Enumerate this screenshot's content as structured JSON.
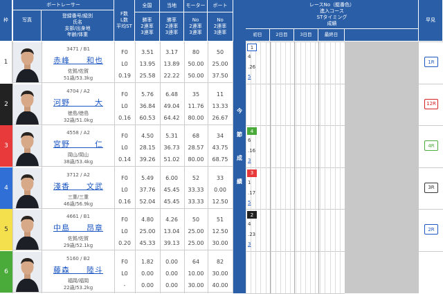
{
  "headers": {
    "waku": "枠",
    "photo": "写真",
    "boat_racer": "ボートレーサー",
    "racer_info": [
      "登録番号/級別",
      "氏名",
      "支部/出身地",
      "年齢/体重"
    ],
    "st": [
      "F数",
      "L数",
      "平均ST"
    ],
    "zenkoku": "全国",
    "touchi": "当地",
    "motor": "モーター",
    "boat": "ボート",
    "rate": [
      "勝率",
      "2連率",
      "3連率"
    ],
    "no_rate": [
      "No",
      "2連率",
      "3連率"
    ],
    "race_info": [
      "レースNo（艇番色）",
      "進入コース",
      "STタイミング",
      "成績"
    ],
    "days": [
      "初日",
      "2日目",
      "3日目",
      "最終日"
    ],
    "hayami": "早見"
  },
  "mid_label": [
    "今",
    "節",
    "成",
    "績"
  ],
  "racers": [
    {
      "waku": "1",
      "waku_color": "#ffffff",
      "waku_text": "#333333",
      "reg": "3471 / B1",
      "name": "赤峰　　和也",
      "branch": "佐賀/佐賀",
      "age_weight": "51歳/53.3kg",
      "st": [
        "F0",
        "L0",
        "0.19"
      ],
      "zenkoku": [
        "3.51",
        "13.95",
        "25.58"
      ],
      "touchi": [
        "3.17",
        "13.89",
        "22.22"
      ],
      "motor": [
        "80",
        "50.00",
        "50.00"
      ],
      "boat": [
        "50",
        "25.00",
        "37.50"
      ],
      "race": {
        "lane": "1",
        "lane_color": "#ffffff",
        "lane_text": "#333333",
        "course": "4",
        "st": ".26",
        "result": "5"
      },
      "hayami": "1R",
      "hayami_color": "#ffffff",
      "hayami_text": "#1a56c2"
    },
    {
      "waku": "2",
      "waku_color": "#222222",
      "waku_text": "#ffffff",
      "reg": "4704 / A2",
      "name": "河野　　　大",
      "branch": "徳島/徳島",
      "age_weight": "32歳/51.0kg",
      "st": [
        "F0",
        "L0",
        "0.16"
      ],
      "zenkoku": [
        "5.76",
        "36.84",
        "60.53"
      ],
      "touchi": [
        "6.48",
        "49.04",
        "64.42"
      ],
      "motor": [
        "35",
        "11.76",
        "80.00"
      ],
      "boat": [
        "11",
        "13.33",
        "26.67"
      ],
      "race": null,
      "hayami": "12R",
      "hayami_color": "#ffffff",
      "hayami_text": "#d42020"
    },
    {
      "waku": "3",
      "waku_color": "#e83a3a",
      "waku_text": "#ffffff",
      "reg": "4558 / A2",
      "name": "宮野　　　仁",
      "branch": "岡山/岡山",
      "age_weight": "38歳/53.4kg",
      "st": [
        "F0",
        "L0",
        "0.14"
      ],
      "zenkoku": [
        "4.50",
        "28.15",
        "39.26"
      ],
      "touchi": [
        "5.31",
        "36.73",
        "51.02"
      ],
      "motor": [
        "68",
        "28.57",
        "80.00"
      ],
      "boat": [
        "34",
        "43.75",
        "68.75"
      ],
      "race": {
        "lane": "4",
        "lane_color": "#4aaa3a",
        "lane_text": "#ffffff",
        "course": "6",
        "st": ".16",
        "result": "3"
      },
      "hayami": "4R",
      "hayami_color": "#ffffff",
      "hayami_text": "#4aaa3a"
    },
    {
      "waku": "4",
      "waku_color": "#2f6fd6",
      "waku_text": "#ffffff",
      "reg": "3712 / A2",
      "name": "淺香　　文武",
      "branch": "三重/三重",
      "age_weight": "46歳/56.9kg",
      "st": [
        "F0",
        "L0",
        "0.16"
      ],
      "zenkoku": [
        "5.49",
        "37.76",
        "52.04"
      ],
      "touchi": [
        "6.00",
        "45.45",
        "45.45"
      ],
      "motor": [
        "52",
        "33.33",
        "33.33"
      ],
      "boat": [
        "33",
        "0.00",
        "12.50"
      ],
      "race": {
        "lane": "3",
        "lane_color": "#e83a3a",
        "lane_text": "#ffffff",
        "course": "1",
        "st": ".17",
        "result": "5"
      },
      "hayami": "3R",
      "hayami_color": "#ffffff",
      "hayami_text": "#333333"
    },
    {
      "waku": "5",
      "waku_color": "#f4e04d",
      "waku_text": "#333333",
      "reg": "4661 / B1",
      "name": "中島　　昂章",
      "branch": "佐賀/佐賀",
      "age_weight": "29歳/52.1kg",
      "st": [
        "F0",
        "L0",
        "0.20"
      ],
      "zenkoku": [
        "4.80",
        "25.00",
        "45.33"
      ],
      "touchi": [
        "4.26",
        "13.04",
        "39.13"
      ],
      "motor": [
        "50",
        "25.00",
        "25.00"
      ],
      "boat": [
        "51",
        "12.50",
        "30.00"
      ],
      "race": {
        "lane": "2",
        "lane_color": "#222222",
        "lane_text": "#ffffff",
        "course": "4",
        "st": ".23",
        "result": "3"
      },
      "hayami": "2R",
      "hayami_color": "#ffffff",
      "hayami_text": "#1a56c2"
    },
    {
      "waku": "6",
      "waku_color": "#4aaa3a",
      "waku_text": "#ffffff",
      "reg": "5160 / B2",
      "name": "藤森　　陸斗",
      "branch": "福岡/福岡",
      "age_weight": "22歳/53.2kg",
      "st": [
        "F0",
        "L0",
        "-"
      ],
      "zenkoku": [
        "1.82",
        "0.00",
        "0.00"
      ],
      "touchi": [
        "0.00",
        "0.00",
        "0.00"
      ],
      "motor": [
        "64",
        "10.00",
        "30.00"
      ],
      "boat": [
        "82",
        "30.00",
        "40.00"
      ],
      "race": null,
      "hayami": "",
      "hayami_color": "#ffffff",
      "hayami_text": "#333333"
    }
  ]
}
